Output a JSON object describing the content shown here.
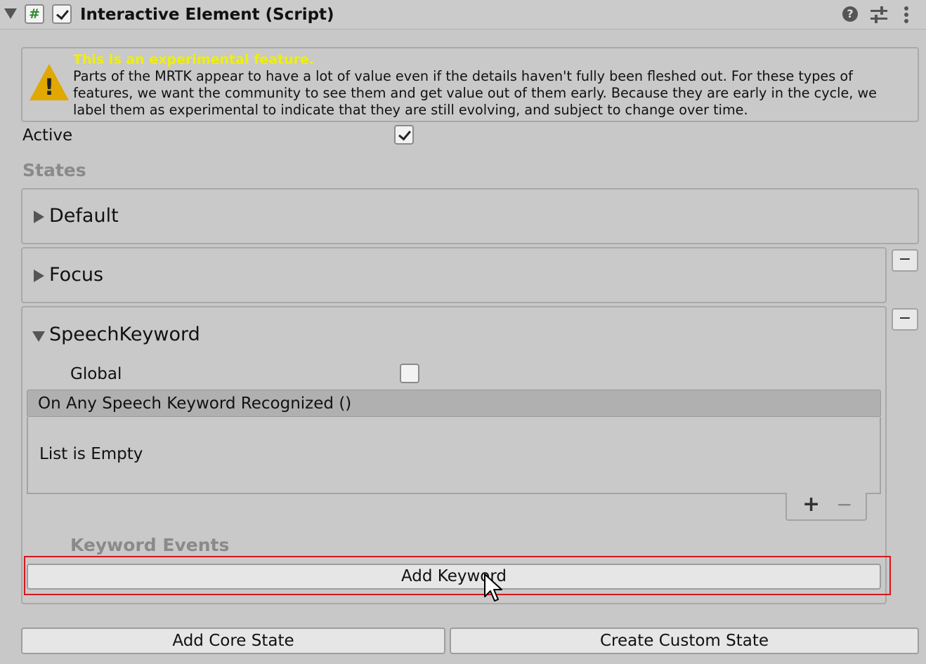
{
  "header": {
    "title": "Interactive Element (Script)",
    "script_icon_glyph": "#",
    "enabled": true,
    "icons": [
      "help-icon",
      "settings-sliders-icon",
      "more-vertical-icon"
    ]
  },
  "warning": {
    "title": "This is an experimental feature.",
    "body": "Parts of the MRTK appear to have a lot of value even if the details haven't fully been fleshed out. For these types of features, we want the community to see them and get value out of them early. Because they are early in the cycle, we label them as experimental to indicate that they are still evolving, and subject to change over time.",
    "title_color": "#f0f000",
    "icon_color": "#e0a800"
  },
  "active": {
    "label": "Active",
    "checked": true
  },
  "states": {
    "header": "States",
    "items": [
      {
        "name": "Default",
        "expanded": false,
        "removable": false
      },
      {
        "name": "Focus",
        "expanded": false,
        "removable": true,
        "remove_label": "−"
      },
      {
        "name": "SpeechKeyword",
        "expanded": true,
        "removable": true,
        "remove_label": "−"
      }
    ]
  },
  "speech": {
    "global_label": "Global",
    "global_checked": false,
    "event_header": "On Any Speech Keyword Recognized ()",
    "event_empty": "List is Empty",
    "add_label": "+",
    "remove_label": "−",
    "keyword_events_header": "Keyword Events",
    "add_keyword_label": "Add Keyword"
  },
  "footer": {
    "add_core_state_label": "Add Core State",
    "create_custom_state_label": "Create Custom State"
  },
  "highlight_color": "#d9161c"
}
